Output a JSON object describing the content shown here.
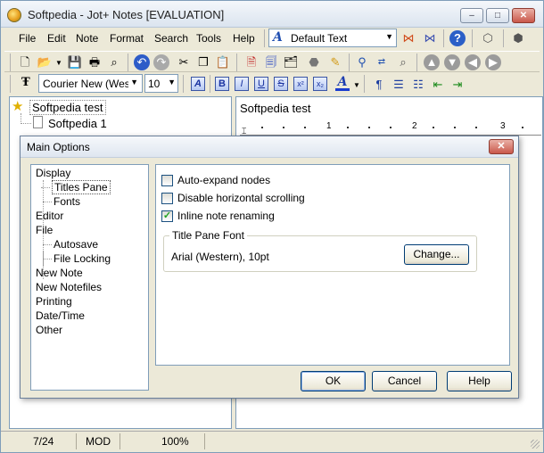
{
  "window": {
    "title": "Softpedia - Jot+ Notes [EVALUATION]",
    "controls": {
      "minimize": "–",
      "maximize": "□",
      "close": "✕"
    }
  },
  "menu": [
    "File",
    "Edit",
    "Note",
    "Format",
    "Search",
    "Tools",
    "Help"
  ],
  "style_selector": {
    "value": "Default Text"
  },
  "font_selector": {
    "font": "Courier New (Weste",
    "size": "10"
  },
  "tree": {
    "root": "Softpedia test",
    "children": [
      "Softpedia 1"
    ]
  },
  "editor": {
    "note_title": "Softpedia test",
    "ruler": [
      "1",
      "2",
      "3"
    ]
  },
  "status": {
    "position": "7/24",
    "mode": "MOD",
    "zoom": "100%"
  },
  "dialog": {
    "title": "Main Options",
    "close": "✕",
    "categories": [
      {
        "label": "Display",
        "level": 0
      },
      {
        "label": "Titles Pane",
        "level": 1,
        "selected": true
      },
      {
        "label": "Fonts",
        "level": 1
      },
      {
        "label": "Editor",
        "level": 0
      },
      {
        "label": "File",
        "level": 0
      },
      {
        "label": "Autosave",
        "level": 1
      },
      {
        "label": "File Locking",
        "level": 1
      },
      {
        "label": "New Note",
        "level": 0
      },
      {
        "label": "New Notefiles",
        "level": 0
      },
      {
        "label": "Printing",
        "level": 0
      },
      {
        "label": "Date/Time",
        "level": 0
      },
      {
        "label": "Other",
        "level": 0
      }
    ],
    "options": [
      {
        "label": "Auto-expand nodes",
        "checked": false
      },
      {
        "label": "Disable horizontal scrolling",
        "checked": false
      },
      {
        "label": "Inline note renaming",
        "checked": true
      }
    ],
    "font_group": {
      "label": "Title Pane Font",
      "value": "Arial (Western), 10pt",
      "change_button": "Change..."
    },
    "buttons": {
      "ok": "OK",
      "cancel": "Cancel",
      "help": "Help"
    }
  },
  "colors": {
    "accent": "#1f4eb0",
    "window_bg": "#ece9d8",
    "border": "#7f9db9"
  }
}
